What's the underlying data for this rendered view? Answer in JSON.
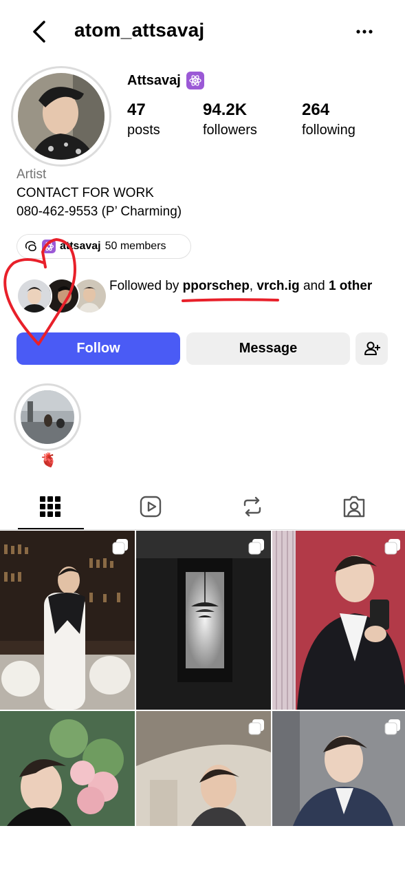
{
  "header": {
    "username": "atom_attsavaj"
  },
  "profile": {
    "display_name": "Attsavaj",
    "badge_glyph": "⚛",
    "stats": [
      {
        "value": "47",
        "label": "posts"
      },
      {
        "value": "94.2K",
        "label": "followers"
      },
      {
        "value": "264",
        "label": "following"
      }
    ],
    "category": "Artist",
    "bio_lines": [
      "CONTACT FOR WORK",
      "080-462-9553 (P’ Charming)"
    ]
  },
  "thread_chip": {
    "name": "attsavaj",
    "members": "50 members"
  },
  "followed_by": {
    "prefix": "Followed by ",
    "user1": "pporschep",
    "sep": ", ",
    "user2": "vrch.ig",
    "mid": " and ",
    "more": "1 other"
  },
  "actions": {
    "follow": "Follow",
    "message": "Message"
  },
  "highlight": {
    "label": "🫀"
  },
  "tabs": [
    "grid-icon",
    "reels-icon",
    "reposts-icon",
    "tagged-icon"
  ],
  "colors": {
    "follow_blue": "#4a5bf5",
    "badge_purple": "#9b59d6",
    "annotation_red": "#e8202a"
  }
}
